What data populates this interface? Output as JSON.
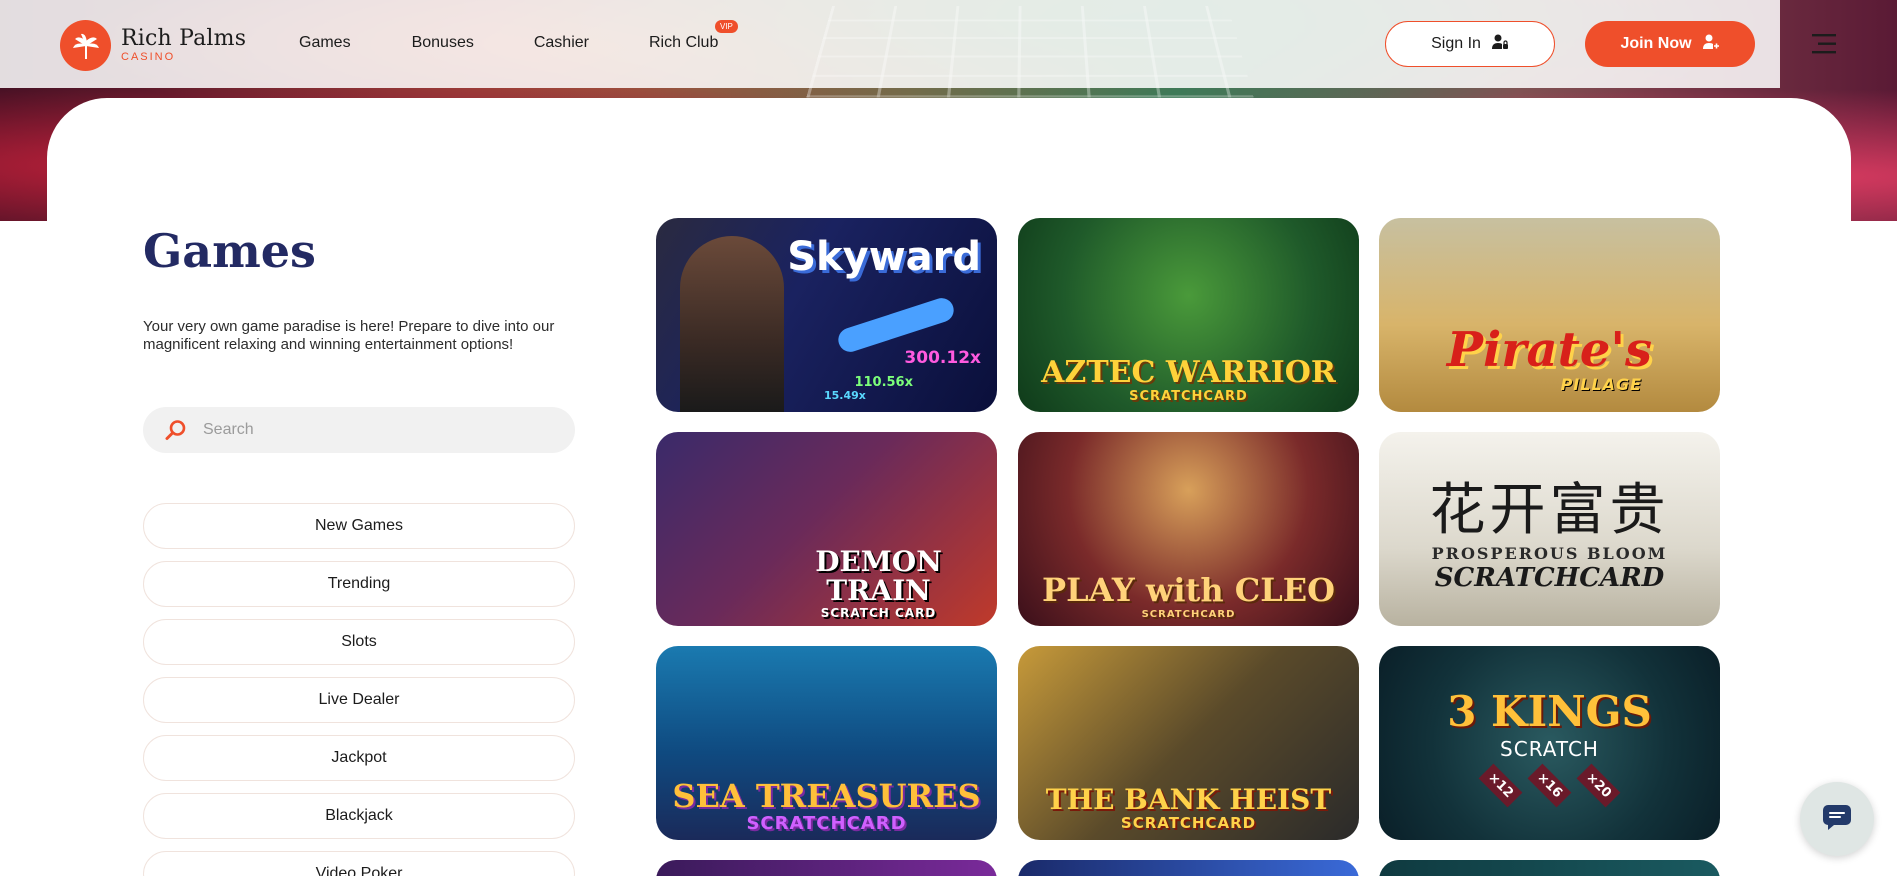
{
  "brand": {
    "name": "Rich Palms",
    "subtitle": "CASINO",
    "accent_color": "#ef4f2b",
    "heading_color": "#232a63"
  },
  "nav": {
    "items": [
      {
        "label": "Games"
      },
      {
        "label": "Bonuses"
      },
      {
        "label": "Cashier"
      },
      {
        "label": "Rich Club",
        "badge": "VIP"
      }
    ]
  },
  "header": {
    "sign_in_label": "Sign In",
    "join_label": "Join Now"
  },
  "page": {
    "title": "Games",
    "description": "Your very own game paradise is here! Prepare to dive into our magnificent relaxing and winning entertainment options!"
  },
  "search": {
    "placeholder": "Search",
    "value": ""
  },
  "categories": [
    {
      "label": "New Games"
    },
    {
      "label": "Trending"
    },
    {
      "label": "Slots"
    },
    {
      "label": "Live Dealer"
    },
    {
      "label": "Jackpot"
    },
    {
      "label": "Blackjack"
    },
    {
      "label": "Video Poker"
    }
  ],
  "games": [
    {
      "title": "Skyward",
      "multipliers": [
        "300.12x",
        "110.56x",
        "15.49x"
      ]
    },
    {
      "title": "AZTEC WARRIOR",
      "subtitle": "SCRATCHCARD"
    },
    {
      "title": "Pirate's",
      "subtitle": "PILLAGE"
    },
    {
      "title": "DEMON TRAIN",
      "subtitle": "SCRATCH CARD"
    },
    {
      "title": "PLAY with CLEO",
      "subtitle": "SCRATCHCARD"
    },
    {
      "chinese": "花开富贵",
      "title": "PROSPEROUS BLOOM",
      "subtitle": "SCRATCHCARD"
    },
    {
      "title": "SEA TREASURES",
      "subtitle": "SCRATCHCARD"
    },
    {
      "title": "THE BANK HEIST",
      "subtitle": "SCRATCHCARD"
    },
    {
      "title": "3 KINGS",
      "subtitle": "SCRATCH",
      "chips": [
        "×12",
        "×16",
        "×20"
      ]
    }
  ],
  "icons": {
    "logo": "palm-logo-icon",
    "sign_in": "user-lock-icon",
    "join": "user-plus-icon",
    "menu": "hamburger-menu-icon",
    "search": "search-icon",
    "chat": "chat-bubble-icon"
  }
}
